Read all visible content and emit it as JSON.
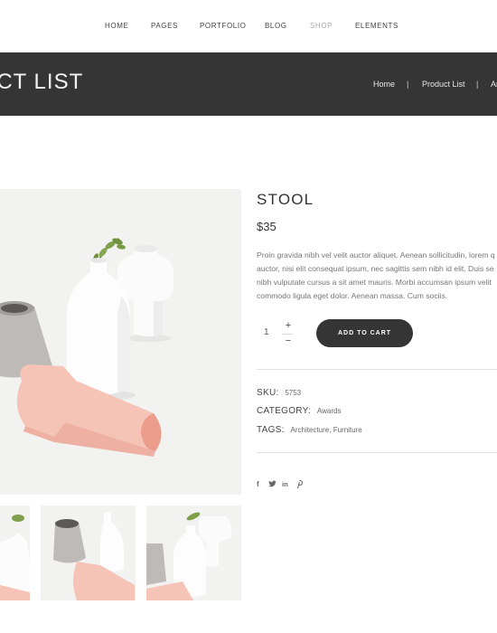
{
  "nav": {
    "items": [
      "HOME",
      "PAGES",
      "PORTFOLIO",
      "BLOG",
      "SHOP",
      "ELEMENTS"
    ],
    "active_index": 4
  },
  "header": {
    "title": "UCT LIST",
    "breadcrumb": {
      "home": "Home",
      "sep": "|",
      "current": "Product List",
      "next": "Ar"
    }
  },
  "product": {
    "name": "STOOL",
    "price": "$35",
    "description_lines": [
      "Proin gravida nibh vel velit auctor aliquet. Aenean sollicitudin, lorem q",
      "auctor, nisi elit consequat ipsum, nec sagittis sem nibh id elit. Duis se",
      "nibh vulputate cursus a sit amet mauris. Morbi accumsan ipsum velit",
      "commodo ligula eget dolor. Aenean massa. Cum sociis."
    ],
    "quantity": "1",
    "qty_plus": "+",
    "qty_minus": "−",
    "add_to_cart": "ADD TO CART",
    "sku_label": "SKU:",
    "sku_value": "5753",
    "category_label": "CATEGORY:",
    "category_value": "Awards",
    "tags_label": "TAGS:",
    "tags": [
      "Architecture",
      "Furniture"
    ],
    "tags_sep": ", "
  },
  "social": {
    "facebook": "f",
    "twitter": "🐦",
    "linkedin": "in",
    "pinterest": "℗"
  },
  "colors": {
    "dark": "#353535",
    "peach": "#f4c1b6",
    "white_vase": "#ffffff",
    "grey_vase": "#b9b6b3"
  },
  "icons": [
    "facebook-icon",
    "twitter-icon",
    "linkedin-icon",
    "pinterest-icon"
  ]
}
